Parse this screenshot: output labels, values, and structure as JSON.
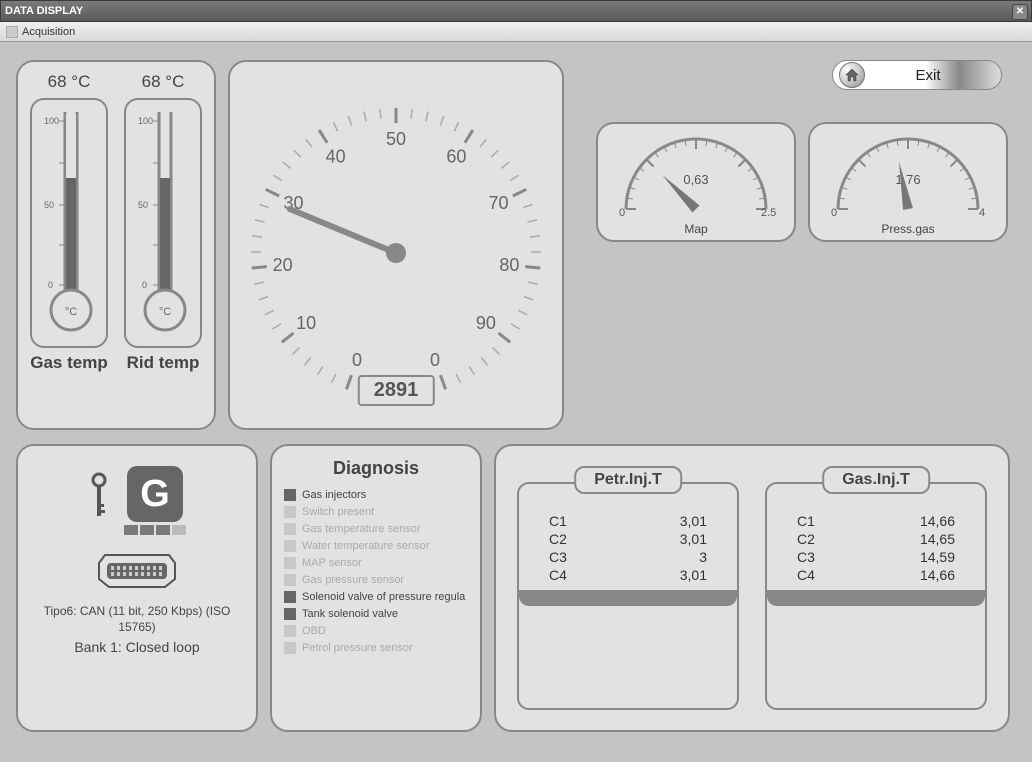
{
  "window": {
    "title": "DATA DISPLAY"
  },
  "menu": {
    "item1": "Acquisition"
  },
  "exit": {
    "label": "Exit"
  },
  "thermo": {
    "gas": {
      "value": "68 °C",
      "label": "Gas temp",
      "temp": 68
    },
    "rid": {
      "value": "68 °C",
      "label": "Rid temp",
      "temp": 68
    }
  },
  "dial": {
    "value": "2891",
    "ticks": [
      "0",
      "10",
      "20",
      "30",
      "40",
      "50",
      "60",
      "70",
      "80",
      "90",
      "0"
    ]
  },
  "gauges": {
    "map": {
      "label": "Map",
      "value": "0,63",
      "min": "0",
      "max": "2.5",
      "numeric": 0.63,
      "range": 2.5
    },
    "press": {
      "label": "Press.gas",
      "value": "1,76",
      "min": "0",
      "max": "4",
      "numeric": 1.76,
      "range": 4
    }
  },
  "status": {
    "g_letter": "G",
    "line1": "Tipo6: CAN (11 bit, 250 Kbps) (ISO 15765)",
    "line2": "Bank 1: Closed loop"
  },
  "diagnosis": {
    "title": "Diagnosis",
    "items": [
      {
        "label": "Gas injectors",
        "active": true
      },
      {
        "label": "Switch present",
        "active": false
      },
      {
        "label": "Gas temperature sensor",
        "active": false
      },
      {
        "label": "Water temperature sensor",
        "active": false
      },
      {
        "label": "MAP sensor",
        "active": false
      },
      {
        "label": "Gas pressure sensor",
        "active": false
      },
      {
        "label": "Solenoid valve of pressure regula",
        "active": true
      },
      {
        "label": "Tank solenoid valve",
        "active": true
      },
      {
        "label": "OBD",
        "active": false
      },
      {
        "label": "Petrol pressure sensor",
        "active": false
      }
    ]
  },
  "inj": {
    "petr": {
      "title": "Petr.Inj.T",
      "rows": [
        {
          "c": "C1",
          "v": "3,01"
        },
        {
          "c": "C2",
          "v": "3,01"
        },
        {
          "c": "C3",
          "v": "3"
        },
        {
          "c": "C4",
          "v": "3,01"
        }
      ]
    },
    "gas": {
      "title": "Gas.Inj.T",
      "rows": [
        {
          "c": "C1",
          "v": "14,66"
        },
        {
          "c": "C2",
          "v": "14,65"
        },
        {
          "c": "C3",
          "v": "14,59"
        },
        {
          "c": "C4",
          "v": "14,66"
        }
      ]
    }
  }
}
